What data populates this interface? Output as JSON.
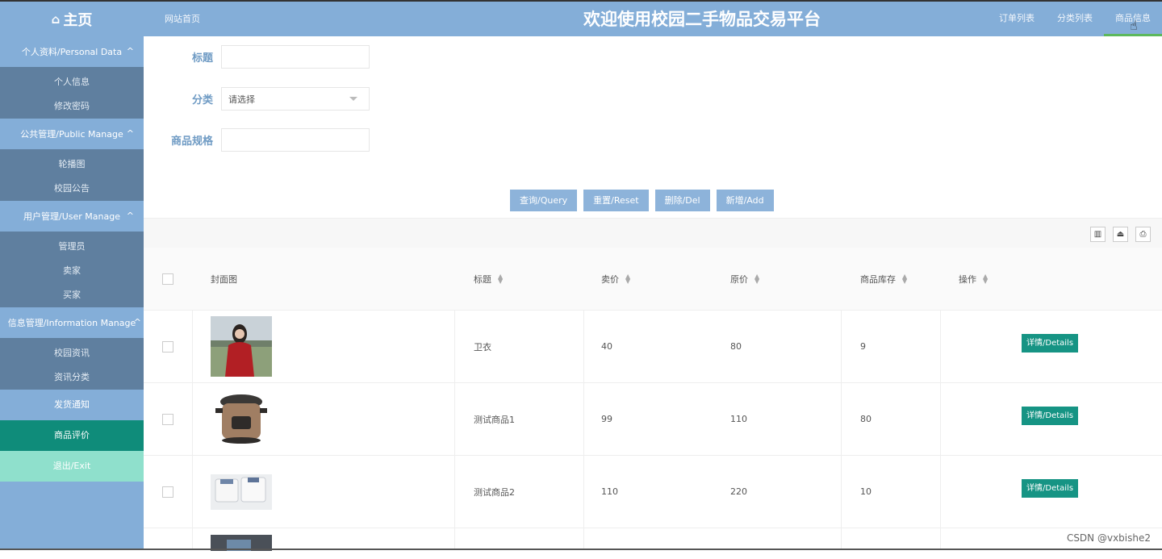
{
  "header": {
    "home_icon": "home-icon",
    "home_label": "主页",
    "site_home": "网站首页",
    "title": "欢迎使用校园二手物品交易平台",
    "nav": [
      "订单列表",
      "分类列表",
      "商品信息"
    ],
    "active_nav": "商品信息"
  },
  "sidebar": {
    "groups": [
      {
        "label": "个人资料/Personal Data",
        "items": [
          "个人信息",
          "修改密码"
        ]
      },
      {
        "label": "公共管理/Public Manage",
        "items": [
          "轮播图",
          "校园公告"
        ]
      },
      {
        "label": "用户管理/User Manage",
        "items": [
          "管理员",
          "卖家",
          "买家"
        ]
      },
      {
        "label": "信息管理/Information Manage",
        "items": [
          "校园资讯",
          "资讯分类"
        ]
      }
    ],
    "solo": [
      "发货通知",
      "商品评价",
      "退出/Exit"
    ],
    "active": "商品评价"
  },
  "filters": {
    "title_label": "标题",
    "category_label": "分类",
    "category_placeholder": "请选择",
    "spec_label": "商品规格"
  },
  "buttons": {
    "query": "查询/Query",
    "reset": "重置/Reset",
    "delete": "删除/Del",
    "add": "新增/Add"
  },
  "table": {
    "columns": [
      "封面图",
      "标题",
      "卖价",
      "原价",
      "商品库存",
      "操作"
    ],
    "rows": [
      {
        "title": "卫衣",
        "price": "40",
        "original": "80",
        "stock": "9",
        "action": "详情/Details",
        "thumb": "red-coat-girl"
      },
      {
        "title": "测试商品1",
        "price": "99",
        "original": "110",
        "stock": "80",
        "action": "详情/Details",
        "thumb": "pressure-cooker"
      },
      {
        "title": "测试商品2",
        "price": "110",
        "original": "220",
        "stock": "10",
        "action": "详情/Details",
        "thumb": "folded-tshirts"
      }
    ]
  },
  "watermark": "CSDN @vxbishe2",
  "colors": {
    "topbar": "#84aed8",
    "sidebar_sub": "#5f7f9f",
    "active": "#0f8c7a",
    "exit": "#8fe0cc",
    "detail": "#169484",
    "button": "#8db3da"
  }
}
